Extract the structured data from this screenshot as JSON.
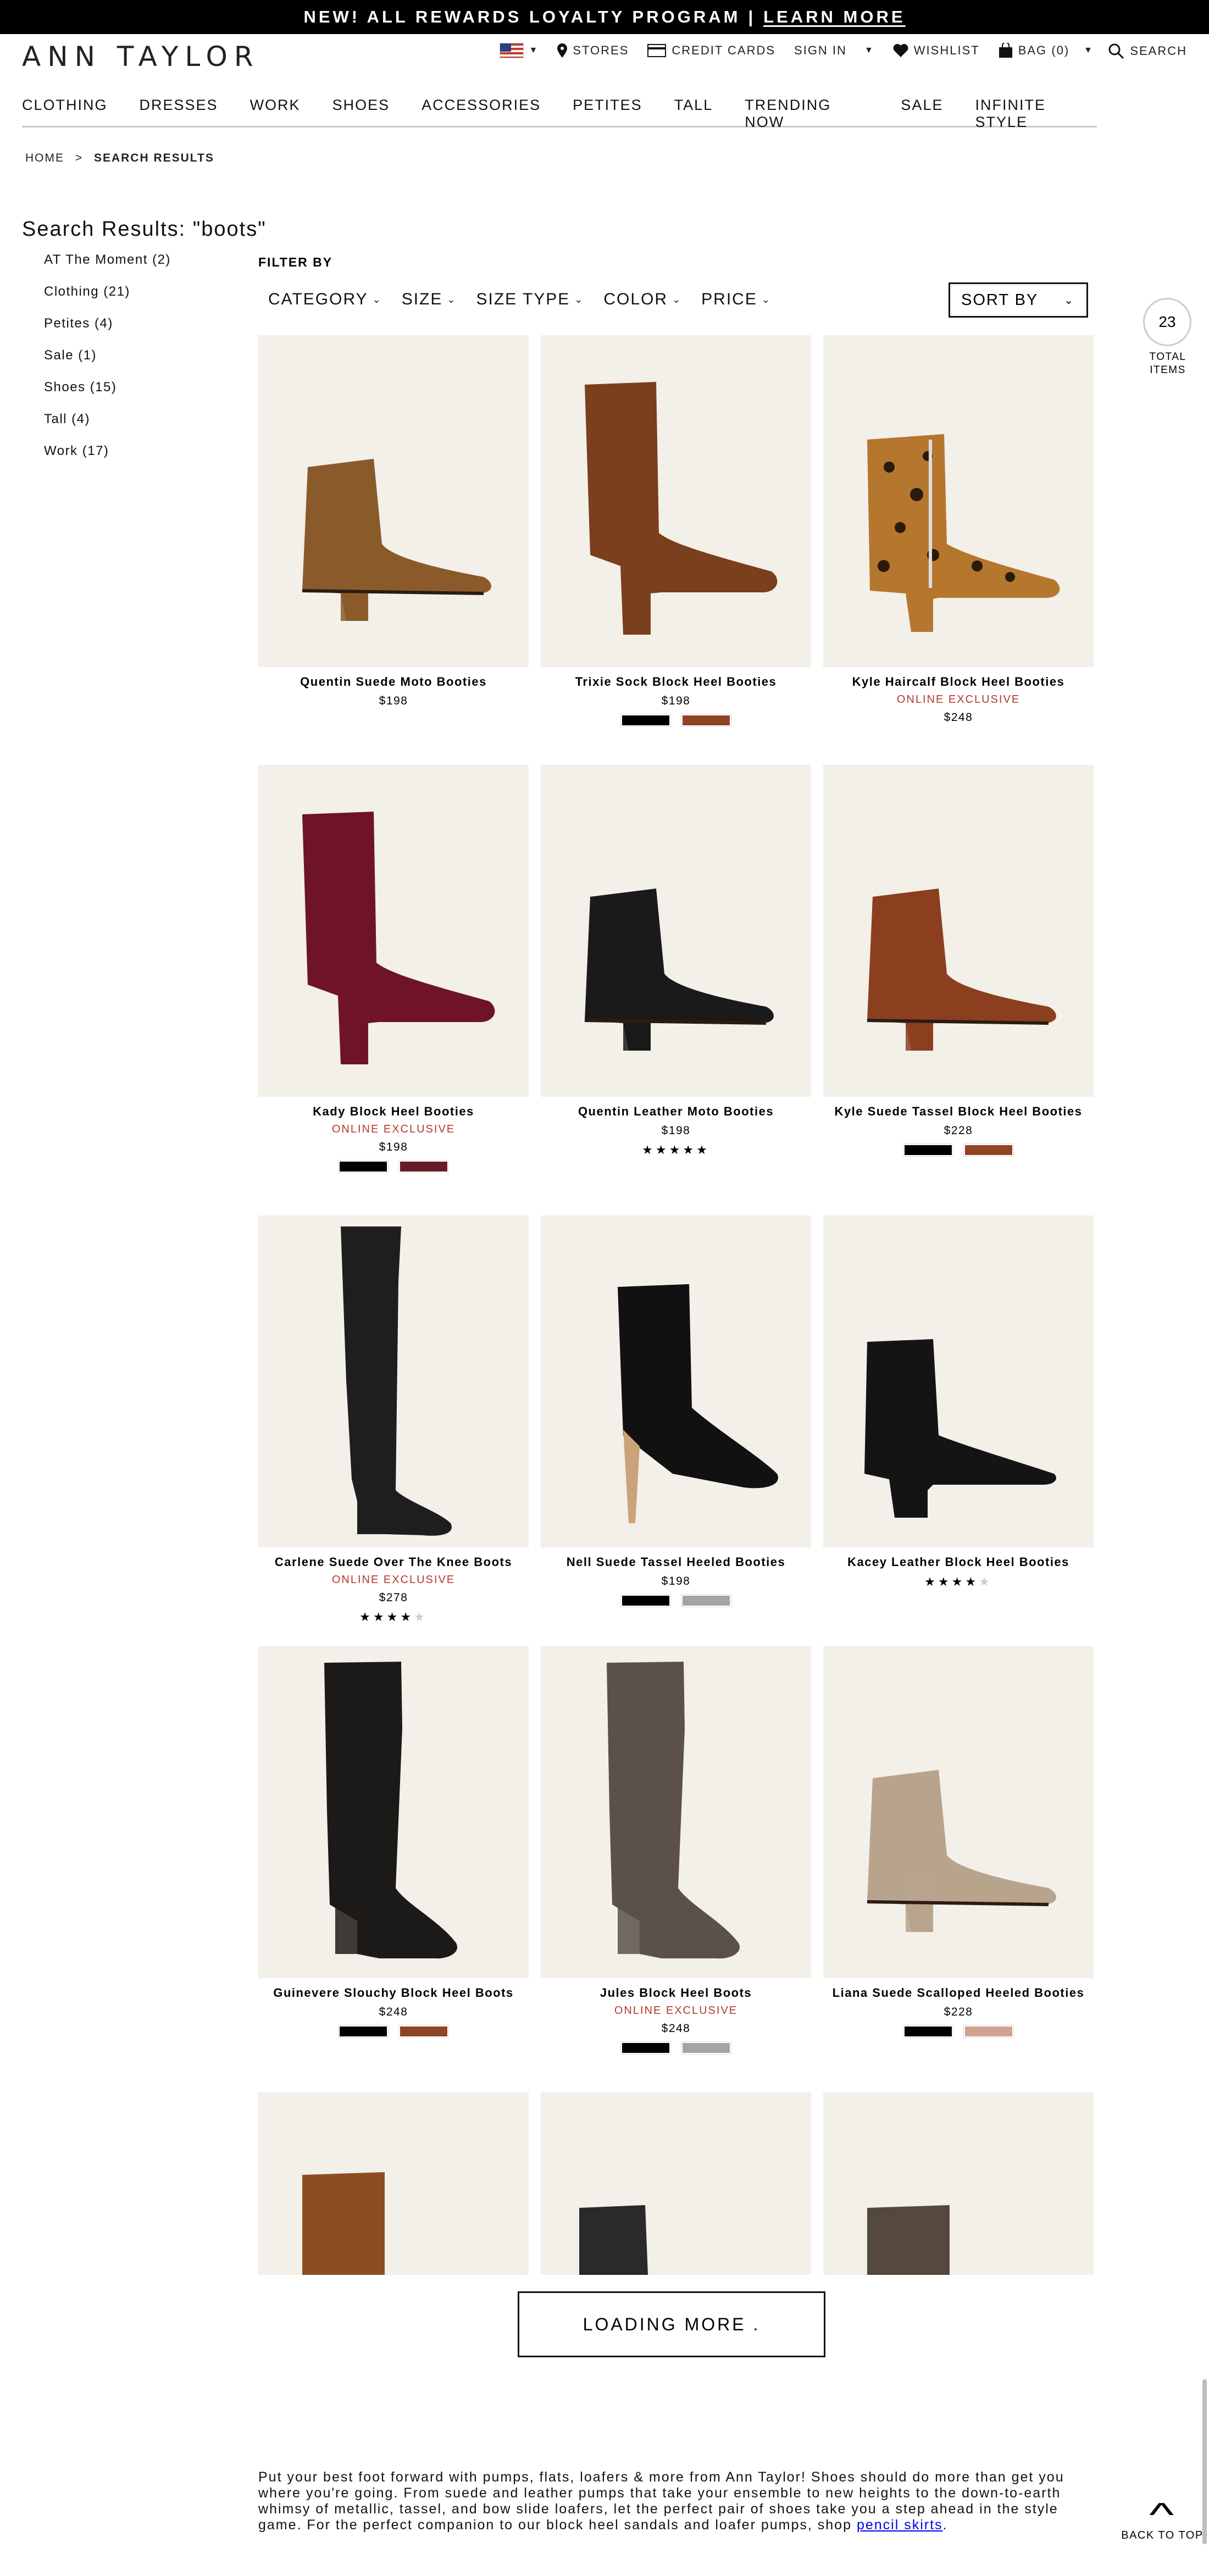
{
  "promo": {
    "text": "NEW! ALL REWARDS LOYALTY PROGRAM",
    "separator": "|",
    "link": "LEARN MORE"
  },
  "header": {
    "logo": "ANN TAYLOR",
    "utility": {
      "stores": "STORES",
      "credit_cards": "CREDIT CARDS",
      "sign_in": "SIGN IN",
      "wishlist": "WISHLIST",
      "bag": "BAG (0)",
      "search": "SEARCH"
    }
  },
  "nav": [
    "CLOTHING",
    "DRESSES",
    "WORK",
    "SHOES",
    "ACCESSORIES",
    "PETITES",
    "TALL",
    "TRENDING NOW",
    "SALE",
    "INFINITE STYLE"
  ],
  "breadcrumb": {
    "home": "HOME",
    "sep": ">",
    "current": "SEARCH RESULTS"
  },
  "results_title": "Search Results: \"boots\"",
  "facets": [
    "AT The Moment (2)",
    "Clothing (21)",
    "Petites (4)",
    "Sale (1)",
    "Shoes (15)",
    "Tall (4)",
    "Work (17)"
  ],
  "filter_label": "FILTER BY",
  "filters": [
    "CATEGORY",
    "SIZE",
    "SIZE TYPE",
    "COLOR",
    "PRICE"
  ],
  "sort_label": "SORT BY",
  "total": {
    "count": "23",
    "label_line1": "TOTAL",
    "label_line2": "ITEMS"
  },
  "products": [
    {
      "name": "Quentin Suede Moto Booties",
      "exclusive": "",
      "price": "$198",
      "swatches": [],
      "rating": 0,
      "boot": "ankle",
      "color": "#8b5a2b"
    },
    {
      "name": "Trixie Sock Block Heel Booties",
      "exclusive": "",
      "price": "$198",
      "swatches": [
        "#000000",
        "#8e4425"
      ],
      "rating": 0,
      "boot": "sock",
      "color": "#7a3f1d"
    },
    {
      "name": "Kyle Haircalf Block Heel Booties",
      "exclusive": "ONLINE EXCLUSIVE",
      "price": "$248",
      "swatches": [],
      "rating": 0,
      "boot": "leopard",
      "color": "#b5762e"
    },
    {
      "name": "Kady Block Heel Booties",
      "exclusive": "ONLINE EXCLUSIVE",
      "price": "$198",
      "swatches": [
        "#000000",
        "#6b1a2a"
      ],
      "rating": 0,
      "boot": "sock",
      "color": "#6e1426"
    },
    {
      "name": "Quentin Leather Moto Booties",
      "exclusive": "",
      "price": "$198",
      "swatches": [],
      "rating": 5,
      "boot": "ankle",
      "color": "#1a1a1a"
    },
    {
      "name": "Kyle Suede Tassel Block Heel Booties",
      "exclusive": "",
      "price": "$228",
      "swatches": [
        "#000000",
        "#8e4425"
      ],
      "rating": 0,
      "boot": "ankle",
      "color": "#8b3f1f"
    },
    {
      "name": "Carlene Suede Over The Knee Boots",
      "exclusive": "ONLINE EXCLUSIVE",
      "price": "$278",
      "swatches": [],
      "rating": 4,
      "boot": "otk",
      "color": "#1e1e1e"
    },
    {
      "name": "Nell Suede Tassel Heeled Booties",
      "exclusive": "",
      "price": "$198",
      "swatches": [
        "#000000",
        "#a8a3a0"
      ],
      "rating": 0,
      "boot": "stiletto",
      "color": "#111111"
    },
    {
      "name": "Kacey Leather Block Heel Booties",
      "exclusive": "",
      "price": "",
      "swatches": [],
      "rating": 4,
      "boot": "pointed",
      "color": "#141414"
    },
    {
      "name": "Guinevere Slouchy Block Heel Boots",
      "exclusive": "",
      "price": "$248",
      "swatches": [
        "#000000",
        "#8e4425"
      ],
      "rating": 0,
      "boot": "tall",
      "color": "#1c1a18"
    },
    {
      "name": "Jules Block Heel Boots",
      "exclusive": "ONLINE EXCLUSIVE",
      "price": "$248",
      "swatches": [
        "#000000",
        "#a8a3a0"
      ],
      "rating": 0,
      "boot": "tall",
      "color": "#5b504b"
    },
    {
      "name": "Liana Suede Scalloped Heeled Booties",
      "exclusive": "",
      "price": "$228",
      "swatches": [
        "#000000",
        "#d1a291"
      ],
      "rating": 0,
      "boot": "ankle",
      "color": "#b8a48d"
    }
  ],
  "partial_products": [
    {
      "color": "#8b4e22"
    },
    {
      "color": "#2a2a2a"
    },
    {
      "color": "#55483f"
    }
  ],
  "loading": "LOADING MORE .",
  "seo": {
    "text": "Put your best foot forward with pumps, flats, loafers & more from Ann Taylor! Shoes should do more than get you where you're going. From suede and leather pumps that take your ensemble to new heights to the down-to-earth whimsy of metallic, tassel, and bow slide loafers, let the perfect pair of shoes take you a step ahead in the style game. For the perfect companion to our block heel sandals and loafer pumps, shop",
    "link": "pencil skirts",
    "end": "."
  },
  "back_to_top": "BACK TO TOP",
  "colors": {
    "accent_red": "#b03a2e",
    "promo_bg": "#000000",
    "image_bg": "#f3efe9"
  }
}
